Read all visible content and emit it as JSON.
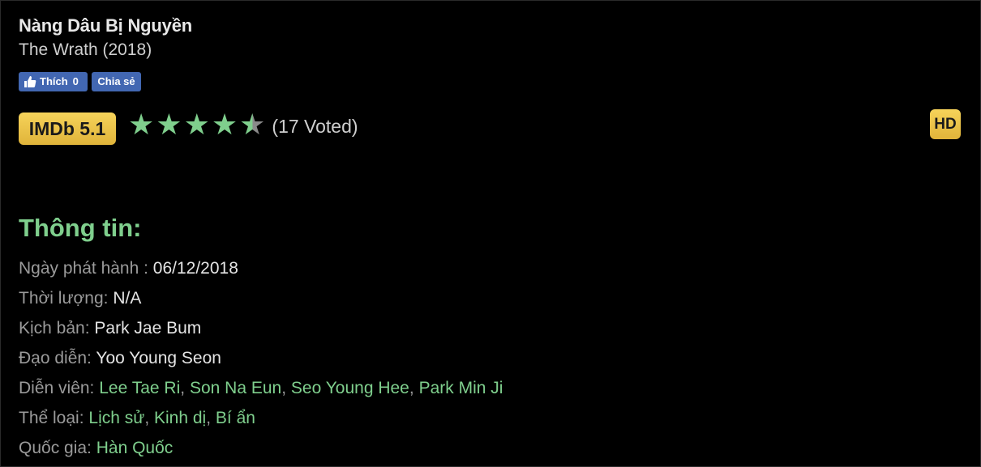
{
  "movie": {
    "title": "Nàng Dâu Bị Nguyền",
    "original_title": "The Wrath (2018)"
  },
  "social": {
    "like_label": "Thích",
    "like_count": "0",
    "share_label": "Chia sẻ"
  },
  "rating": {
    "imdb_label": "IMDb 5.1",
    "stars": 4.5,
    "votes": "(17 Voted)"
  },
  "quality_badge": "HD",
  "info": {
    "heading": "Thông tin:",
    "release_label": "Ngày phát hành :",
    "release_value": "06/12/2018",
    "duration_label": "Thời lượng:",
    "duration_value": "N/A",
    "writer_label": "Kịch bản:",
    "writer_value": "Park Jae Bum",
    "director_label": "Đạo diễn:",
    "director_value": "Yoo Young Seon",
    "cast_label": "Diễn viên:",
    "cast": [
      "Lee Tae Ri",
      "Son Na Eun",
      "Seo Young Hee",
      "Park Min Ji"
    ],
    "genre_label": "Thể loại:",
    "genres": [
      "Lịch sử",
      "Kinh dị",
      "Bí ẩn"
    ],
    "country_label": "Quốc gia:",
    "country_value": "Hàn Quốc"
  },
  "colors": {
    "accent_green": "#7fcf8d",
    "badge_gold": "#f0c54a",
    "facebook_blue": "#4267b2"
  }
}
